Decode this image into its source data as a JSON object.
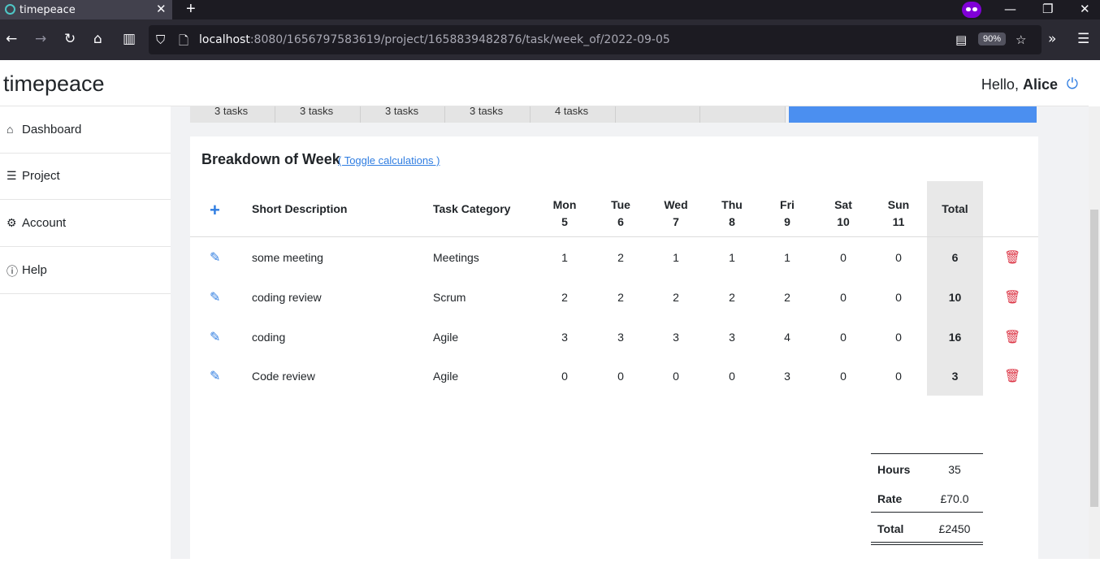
{
  "browser": {
    "tab_title": "timepeace",
    "tab_close": "✕",
    "new_tab": "+",
    "url_host": "localhost",
    "url_path": ":8080/1656797583619/project/1658839482876/task/week_of/2022-09-05",
    "zoom": "90%"
  },
  "app": {
    "brand": "timepeace",
    "greeting": "Hello,",
    "user_name": "Alice"
  },
  "sidebar": {
    "items": [
      {
        "label": "Dashboard",
        "icon": "home-icon"
      },
      {
        "label": "Project",
        "icon": "list-icon"
      },
      {
        "label": "Account",
        "icon": "gear-icon"
      },
      {
        "label": "Help",
        "icon": "help-icon"
      }
    ]
  },
  "day_strip": [
    "3 tasks",
    "3 tasks",
    "3 tasks",
    "3 tasks",
    "4 tasks",
    "",
    ""
  ],
  "breakdown": {
    "title": "Breakdown of Week",
    "toggle_label": "( Toggle calculations )",
    "columns": {
      "description": "Short Description",
      "category": "Task Category",
      "days": [
        {
          "name": "Mon",
          "num": "5"
        },
        {
          "name": "Tue",
          "num": "6"
        },
        {
          "name": "Wed",
          "num": "7"
        },
        {
          "name": "Thu",
          "num": "8"
        },
        {
          "name": "Fri",
          "num": "9"
        },
        {
          "name": "Sat",
          "num": "10"
        },
        {
          "name": "Sun",
          "num": "11"
        }
      ],
      "total": "Total"
    },
    "rows": [
      {
        "description": "some meeting",
        "category": "Meetings",
        "hours": [
          "1",
          "2",
          "1",
          "1",
          "1",
          "0",
          "0"
        ],
        "total": "6"
      },
      {
        "description": "coding review",
        "category": "Scrum",
        "hours": [
          "2",
          "2",
          "2",
          "2",
          "2",
          "0",
          "0"
        ],
        "total": "10"
      },
      {
        "description": "coding",
        "category": "Agile",
        "hours": [
          "3",
          "3",
          "3",
          "3",
          "4",
          "0",
          "0"
        ],
        "total": "16"
      },
      {
        "description": "Code review",
        "category": "Agile",
        "hours": [
          "0",
          "0",
          "0",
          "0",
          "3",
          "0",
          "0"
        ],
        "total": "3"
      }
    ]
  },
  "summary": {
    "hours_label": "Hours",
    "hours_value": "35",
    "rate_label": "Rate",
    "rate_value": "£70.0",
    "total_label": "Total",
    "total_value": "£2450"
  },
  "colors": {
    "accent": "#2f7de1",
    "danger": "#dc3545",
    "active_day": "#4b8ff0"
  }
}
